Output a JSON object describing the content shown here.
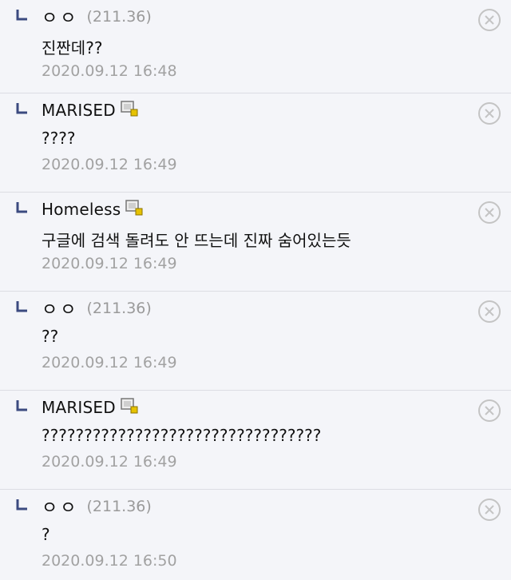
{
  "comments": [
    {
      "nick": "ㅇㅇ",
      "anonymous": true,
      "ip": "(211.36)",
      "text": "진짠데??",
      "date": "2020.09.12 16:48"
    },
    {
      "nick": "MARISED",
      "anonymous": false,
      "ip": "",
      "text": "????",
      "date": "2020.09.12 16:49"
    },
    {
      "nick": "Homeless",
      "anonymous": false,
      "ip": "",
      "text": "구글에 검색 돌려도 안 뜨는데 진짜 숨어있는듯",
      "date": "2020.09.12 16:49"
    },
    {
      "nick": "ㅇㅇ",
      "anonymous": true,
      "ip": "(211.36)",
      "text": "??",
      "date": "2020.09.12 16:49"
    },
    {
      "nick": "MARISED",
      "anonymous": false,
      "ip": "",
      "text": "?????????????????????????????????",
      "date": "2020.09.12 16:49"
    },
    {
      "nick": "ㅇㅇ",
      "anonymous": true,
      "ip": "(211.36)",
      "text": "?",
      "date": "2020.09.12 16:50"
    }
  ],
  "icons": {
    "reply": "reply-arrow-icon",
    "gallog": "gallog-member-icon",
    "delete": "delete-circle-x-icon"
  },
  "colors": {
    "background": "#f4f5f9",
    "divider": "#dcdde3",
    "reply_mark": "#3b4a80",
    "meta_text": "#a2a2a2",
    "delete_icon": "#c4c4c4"
  }
}
